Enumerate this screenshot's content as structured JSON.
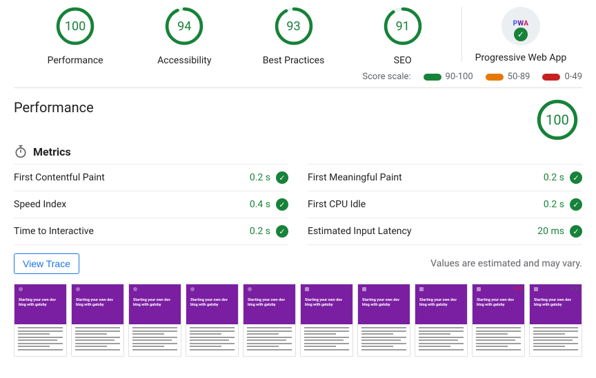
{
  "scores": {
    "performance": {
      "value": 100,
      "label": "Performance"
    },
    "accessibility": {
      "value": 94,
      "label": "Accessibility"
    },
    "best_practices": {
      "value": 93,
      "label": "Best Practices"
    },
    "seo": {
      "value": 91,
      "label": "SEO"
    },
    "pwa": {
      "label": "Progressive Web App"
    }
  },
  "scale": {
    "label": "Score scale:",
    "good": "90-100",
    "avg": "50-89",
    "bad": "0-49"
  },
  "perf_section": {
    "title": "Performance",
    "score": 100,
    "metrics_label": "Metrics",
    "left": [
      {
        "name": "First Contentful Paint",
        "value": "0.2 s"
      },
      {
        "name": "Speed Index",
        "value": "0.4 s"
      },
      {
        "name": "Time to Interactive",
        "value": "0.2 s"
      }
    ],
    "right": [
      {
        "name": "First Meaningful Paint",
        "value": "0.2 s"
      },
      {
        "name": "First CPU Idle",
        "value": "0.2 s"
      },
      {
        "name": "Estimated Input Latency",
        "value": "20 ms"
      }
    ],
    "view_trace": "View Trace",
    "estimate_note": "Values are estimated and may vary."
  },
  "filmstrip": {
    "frame_title": "Starting your own dev blog with gatsby"
  }
}
